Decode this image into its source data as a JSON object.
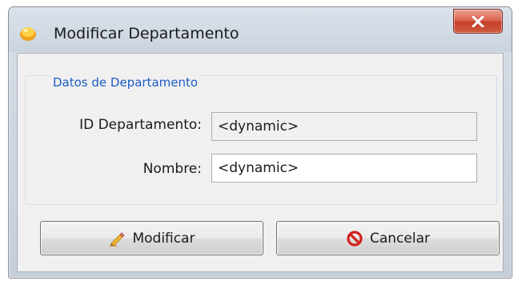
{
  "window": {
    "title": "Modificar Departamento",
    "icon": "app-icon",
    "close_icon": "close-icon"
  },
  "group": {
    "legend": "Datos de Departamento"
  },
  "fields": {
    "id_label": "ID Departamento:",
    "id_value": "<dynamic>",
    "nombre_label": "Nombre:",
    "nombre_value": "<dynamic>"
  },
  "buttons": {
    "modificar_label": "Modificar",
    "modificar_icon": "pencil-icon",
    "cancelar_label": "Cancelar",
    "cancelar_icon": "cancel-icon"
  },
  "colors": {
    "legend_text": "#1e5cc8",
    "close_button": "#c5402a",
    "cancel_icon": "#d1211b"
  }
}
